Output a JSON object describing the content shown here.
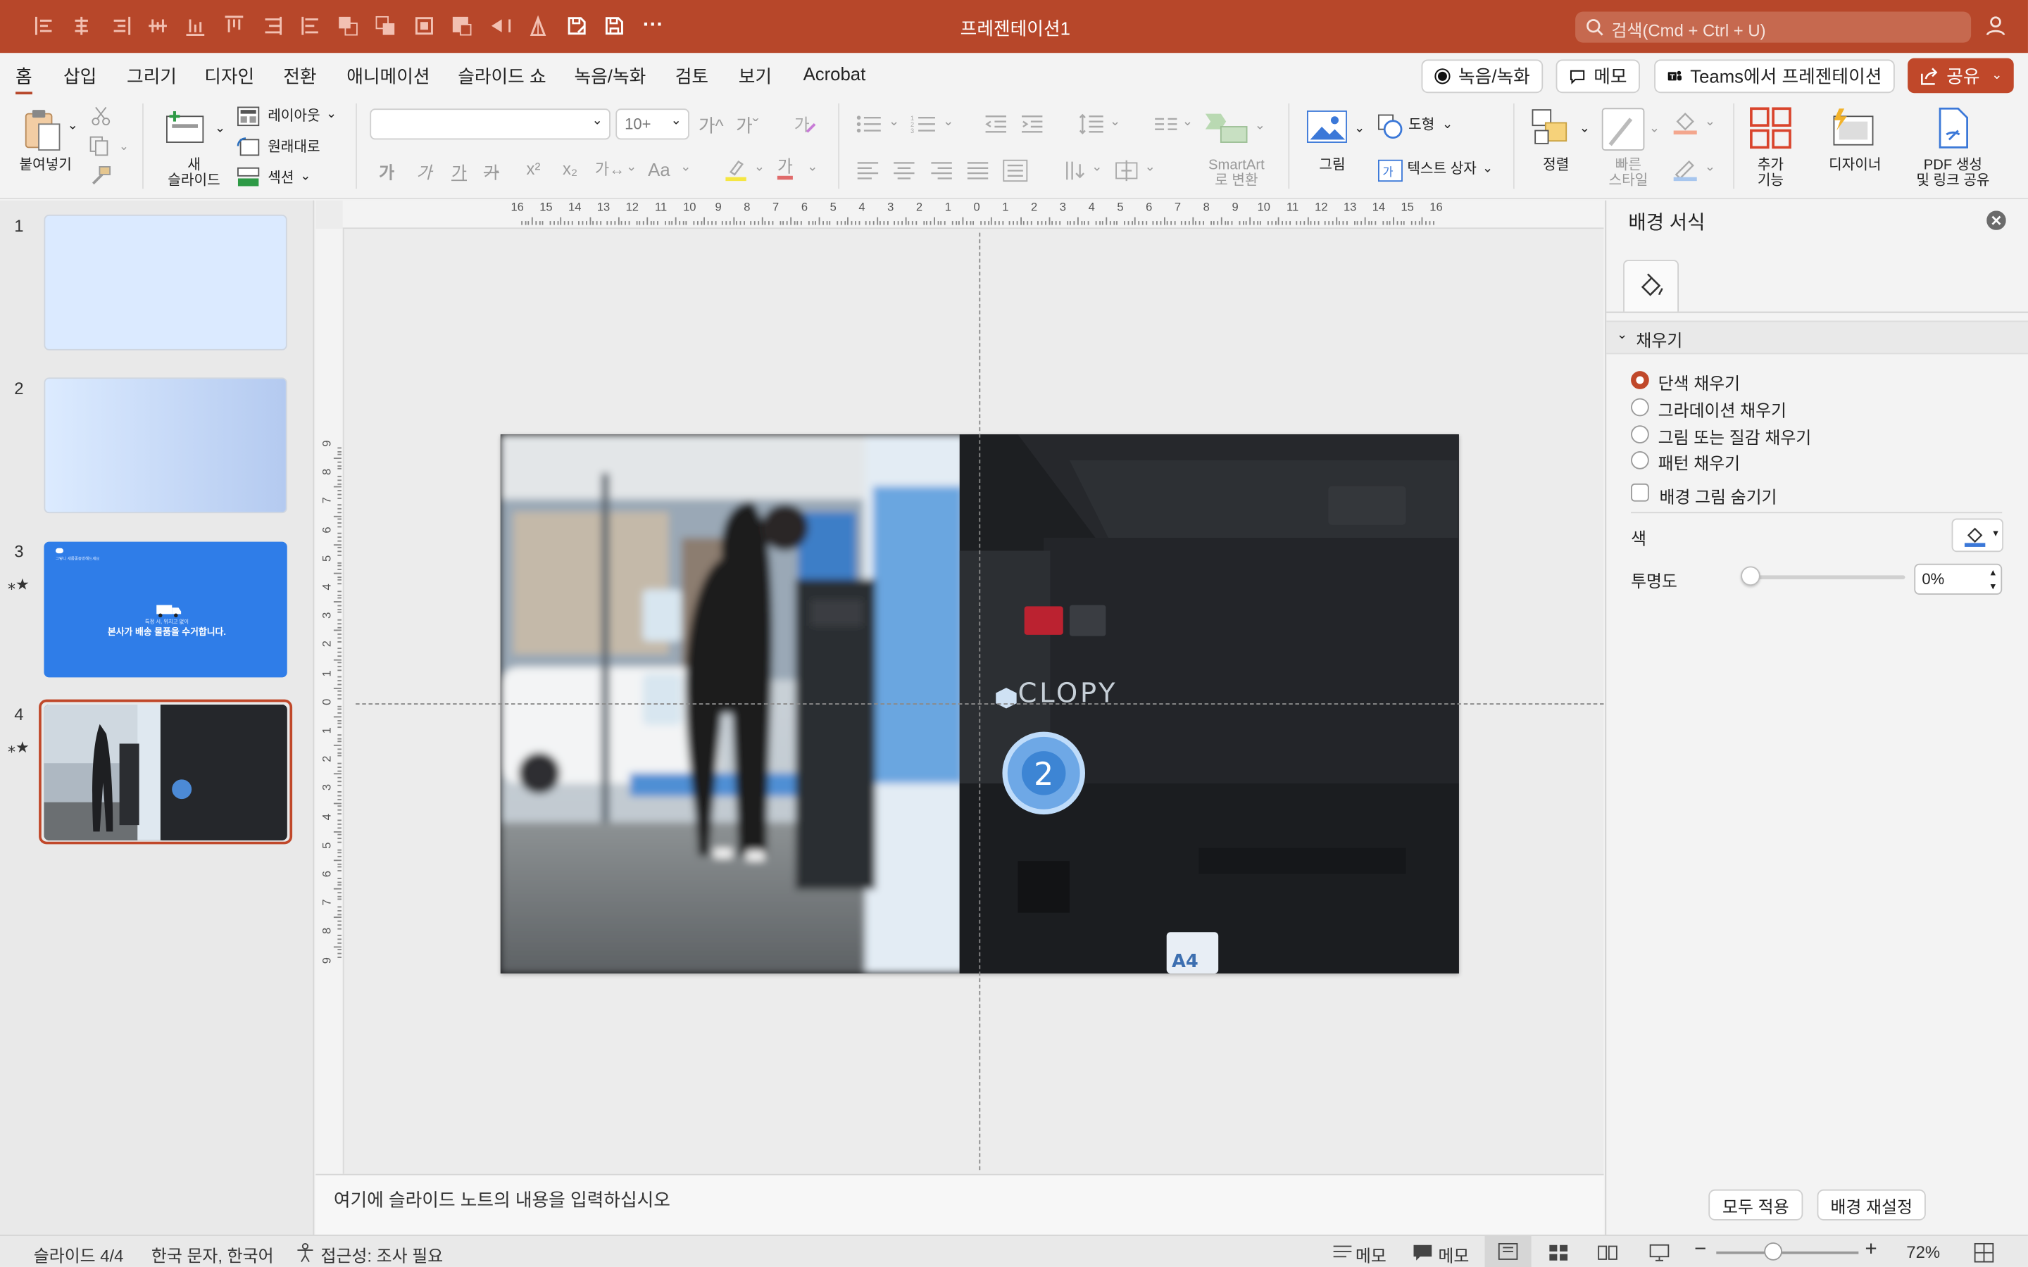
{
  "window": {
    "title": "프레젠테이션1",
    "search_placeholder": "검색(Cmd + Ctrl + U)"
  },
  "menu": {
    "tabs": [
      "홈",
      "삽입",
      "그리기",
      "디자인",
      "전환",
      "애니메이션",
      "슬라이드 쇼",
      "녹음/녹화",
      "검토",
      "보기",
      "Acrobat"
    ],
    "active_tab": "홈",
    "record_label": "녹음/녹화",
    "memo_label": "메모",
    "teams_label": "Teams에서 프레젠테이션",
    "share_label": "공유"
  },
  "ribbon": {
    "paste_label": "붙여넣기",
    "new_slide_line1": "새",
    "new_slide_line2": "슬라이드",
    "layout_label": "레이아웃",
    "reset_label": "원래대로",
    "section_label": "섹션",
    "font_name": "",
    "font_size": "10+",
    "grow_font": "가^",
    "shrink_font": "가ˇ",
    "bold": "가",
    "italic": "가",
    "underline": "가",
    "strike": "가",
    "superscript": "x²",
    "subscript": "x₂",
    "spacing": "가↔",
    "case": "Aa",
    "font_color_glyph": "가",
    "smartart_line1": "SmartArt",
    "smartart_line2": "로 변환",
    "picture_label": "그림",
    "shapes_label": "도형",
    "textbox_label": "텍스트 상자",
    "arrange_label": "정렬",
    "quickstyle_line1": "빠른",
    "quickstyle_line2": "스타일",
    "addins_line1": "추가",
    "addins_line2": "기능",
    "designer_label": "디자이너",
    "pdf_line1": "PDF 생성",
    "pdf_line2": "및 링크 공유"
  },
  "slides": [
    {
      "number": "1",
      "animated": false
    },
    {
      "number": "2",
      "animated": false
    },
    {
      "number": "3",
      "animated": true,
      "small_title": "그렇니 새롭좋종방해드세요",
      "subtitle": "특정 시, 위치고 없이",
      "headline": "본사가 배송 물품을 수거합니다."
    },
    {
      "number": "4",
      "animated": true,
      "selected": true
    }
  ],
  "slide": {
    "brand_text": "CLOPY",
    "badge_number": "2",
    "label_text": "A4"
  },
  "ruler": {
    "h_ticks": [
      "16",
      "15",
      "14",
      "13",
      "12",
      "11",
      "10",
      "9",
      "8",
      "7",
      "6",
      "5",
      "4",
      "3",
      "2",
      "1",
      "0",
      "1",
      "2",
      "3",
      "4",
      "5",
      "6",
      "7",
      "8",
      "9",
      "10",
      "11",
      "12",
      "13",
      "14",
      "15",
      "16"
    ],
    "v_ticks": [
      "9",
      "8",
      "7",
      "6",
      "5",
      "4",
      "3",
      "2",
      "1",
      "0",
      "1",
      "2",
      "3",
      "4",
      "5",
      "6",
      "7",
      "8",
      "9"
    ]
  },
  "notes": {
    "placeholder": "여기에 슬라이드 노트의 내용을 입력하십시오"
  },
  "format_pane": {
    "title": "배경 서식",
    "section": "채우기",
    "options": [
      "단색 채우기",
      "그라데이션 채우기",
      "그림 또는 질감 채우기",
      "패턴 채우기"
    ],
    "selected_option": "단색 채우기",
    "hide_bg_label": "배경 그림 숨기기",
    "color_label": "색",
    "transparency_label": "투명도",
    "transparency_value": "0%",
    "transparency_fraction": 0,
    "apply_all": "모두 적용",
    "reset_bg": "배경 재설정"
  },
  "status": {
    "slide_info": "슬라이드 4/4",
    "language": "한국 문자, 한국어",
    "accessibility": "접근성: 조사 필요",
    "notes_label": "메모",
    "comments_label": "메모",
    "zoom": "72%",
    "zoom_fraction": 0.4
  },
  "colors": {
    "accent": "#b7472a",
    "share": "#c0482a",
    "slide3_bg": "#2f7de8",
    "fill_icon": "#3b78d8"
  }
}
